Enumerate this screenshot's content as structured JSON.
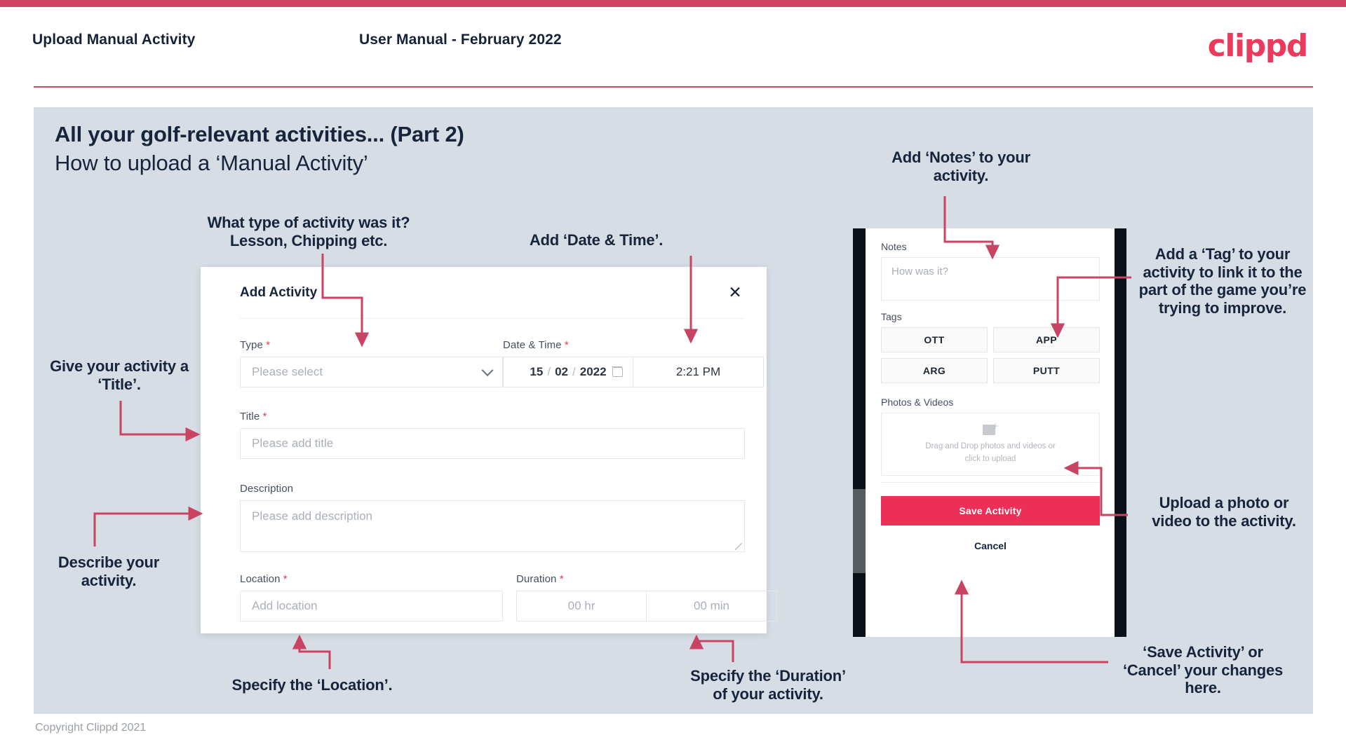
{
  "header": {
    "title": "Upload Manual Activity",
    "subtitle": "User Manual - February 2022",
    "logo": "clippd"
  },
  "slide": {
    "title": "All your golf-relevant activities... (Part 2)",
    "subtitle": "How to upload a ‘Manual Activity’"
  },
  "annotations": {
    "type": "What type of activity was it?\nLesson, Chipping etc.",
    "type_line1": "What type of activity was it?",
    "type_line2": "Lesson, Chipping etc.",
    "datetime": "Add ‘Date & Time’.",
    "title": "Give your activity a\n‘Title’.",
    "title_line1": "Give your activity a",
    "title_line2": "‘Title’.",
    "description_line1": "Describe your",
    "description_line2": "activity.",
    "location": "Specify the ‘Location’.",
    "duration_line1": "Specify the ‘Duration’",
    "duration_line2": "of your activity.",
    "notes_line1": "Add ‘Notes’ to your",
    "notes_line2": "activity.",
    "tag": "Add a ‘Tag’ to your activity to link it to the part of the game you’re trying to improve.",
    "upload_line1": "Upload a photo or",
    "upload_line2": "video to the activity.",
    "save_line1": "‘Save Activity’ or",
    "save_line2": "‘Cancel’ your changes",
    "save_line3": "here."
  },
  "modal": {
    "title": "Add Activity",
    "close_icon": "close-icon",
    "fields": {
      "type": {
        "label": "Type",
        "required": "*",
        "placeholder": "Please select",
        "value": ""
      },
      "datetime": {
        "label": "Date & Time",
        "required": "*",
        "day": "15",
        "month": "02",
        "year": "2022",
        "separator": "/",
        "time": "2:21 PM"
      },
      "title": {
        "label": "Title",
        "required": "*",
        "placeholder": "Please add title",
        "value": ""
      },
      "description": {
        "label": "Description",
        "required": "",
        "placeholder": "Please add description",
        "value": ""
      },
      "location": {
        "label": "Location",
        "required": "*",
        "placeholder": "Add location",
        "value": ""
      },
      "duration": {
        "label": "Duration",
        "required": "*",
        "hours_placeholder": "00 hr",
        "minutes_placeholder": "00 min"
      }
    }
  },
  "phone": {
    "notes": {
      "label": "Notes",
      "placeholder": "How was it?"
    },
    "tags": {
      "label": "Tags",
      "items": [
        "OTT",
        "APP",
        "ARG",
        "PUTT"
      ]
    },
    "photos": {
      "label": "Photos & Videos",
      "dropzone_line1": "Drag and Drop photos and videos or",
      "dropzone_line2": "click to upload",
      "icon": "add-image-icon"
    },
    "save_label": "Save Activity",
    "cancel_label": "Cancel"
  },
  "footer": {
    "copyright": "Copyright Clippd 2021"
  },
  "colors": {
    "brand_pink": "#ec3a5d",
    "accent_red": "#cf4463",
    "slide_bg": "#d6dde5",
    "text_dark": "#16243c",
    "arrow": "#c94462"
  }
}
